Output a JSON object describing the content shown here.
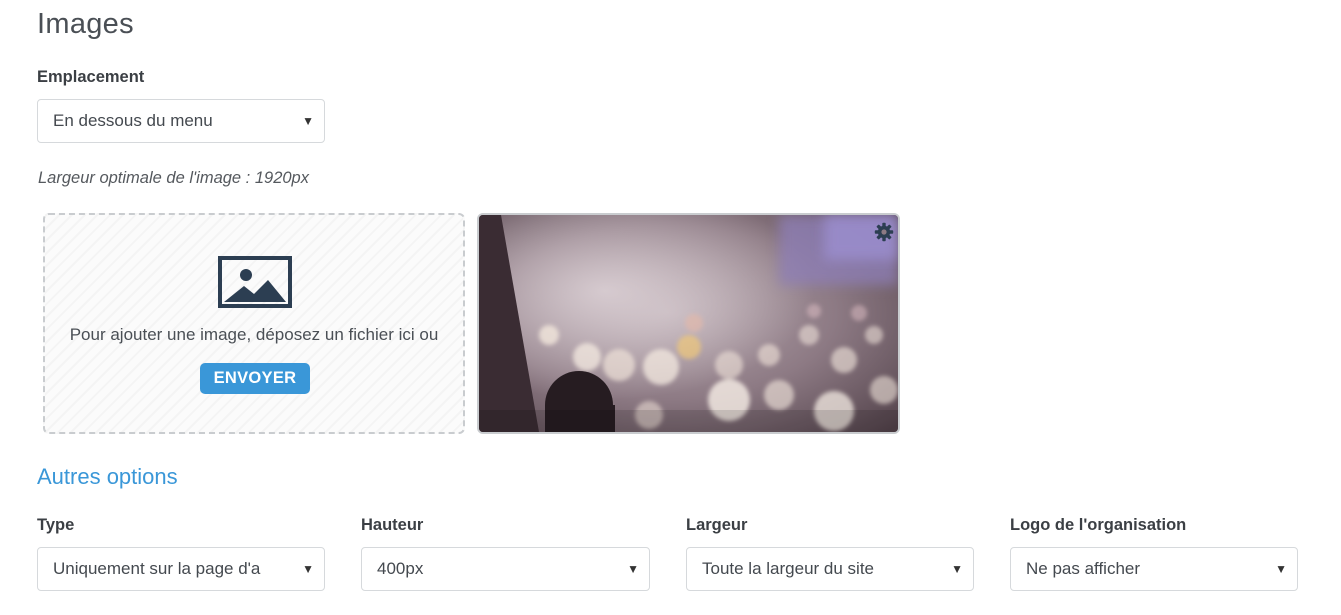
{
  "page": {
    "title": "Images"
  },
  "placement": {
    "label": "Emplacement",
    "selected": "En dessous du menu"
  },
  "image_hint": "Largeur optimale de l'image : 1920px",
  "dropzone": {
    "icon": "image-icon",
    "text": "Pour ajouter une image, déposez un fichier ici ou",
    "button_label": "ENVOYER"
  },
  "preview": {
    "settings_icon": "gear-icon"
  },
  "other_options": {
    "title": "Autres options",
    "fields": [
      {
        "label": "Type",
        "selected": "Uniquement sur la page d'a"
      },
      {
        "label": "Hauteur",
        "selected": "400px"
      },
      {
        "label": "Largeur",
        "selected": "Toute la largeur du site"
      },
      {
        "label": "Logo de l'organisation",
        "selected": "Ne pas afficher"
      }
    ]
  },
  "colors": {
    "accent": "#3a97d8",
    "text": "#3a3f45"
  }
}
